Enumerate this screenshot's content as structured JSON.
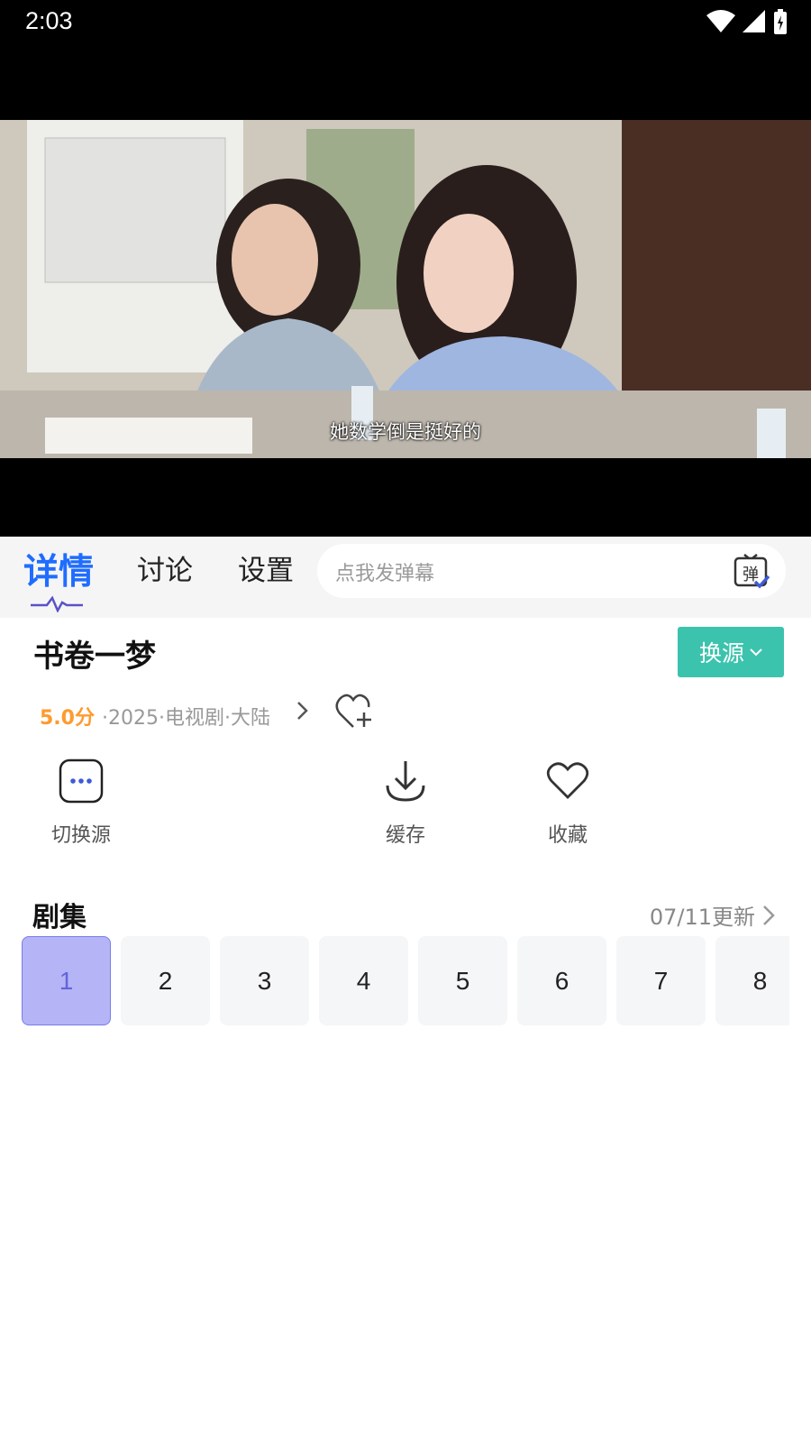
{
  "status_bar": {
    "time": "2:03"
  },
  "player": {
    "subtitle": "她数学倒是挺好的"
  },
  "tabs": [
    {
      "label": "详情",
      "active": true
    },
    {
      "label": "讨论",
      "active": false
    },
    {
      "label": "设置",
      "active": false
    }
  ],
  "danmaku": {
    "placeholder": "点我发弹幕",
    "icon_text": "弹"
  },
  "show": {
    "title": "书卷一梦",
    "switch_source_label": "换源",
    "score": "5.0分",
    "meta": "·2025·电视剧·大陆"
  },
  "actions": {
    "switch_source": "切换源",
    "cache": "缓存",
    "collect": "收藏"
  },
  "episodes": {
    "title": "剧集",
    "update_text": "07/11更新",
    "items": [
      "1",
      "2",
      "3",
      "4",
      "5",
      "6",
      "7",
      "8"
    ],
    "selected": "1"
  },
  "colors": {
    "accent_blue": "#1f6dff",
    "teal_button": "#3cc3ad",
    "score_orange": "#ff9a2e",
    "episode_active_bg": "#b4b4f7"
  }
}
